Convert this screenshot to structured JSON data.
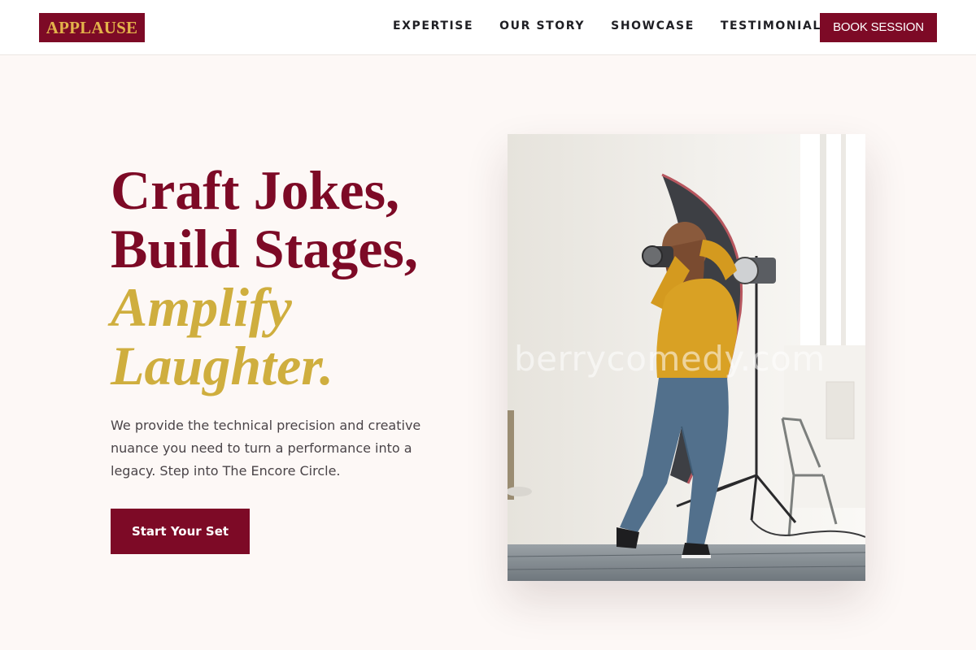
{
  "brand": {
    "logo_text": "APPLAUSE",
    "primary_color": "#7d0a26",
    "accent_color": "#cfae3e"
  },
  "nav": {
    "links": [
      "EXPERTISE",
      "OUR STORY",
      "SHOWCASE",
      "TESTIMONIALS"
    ],
    "cta_label": "BOOK SESSION"
  },
  "hero": {
    "title_lines": [
      "Craft Jokes,",
      "Build Stages,"
    ],
    "accent_lines": [
      "Amplify",
      "Laughter."
    ],
    "description": "We provide the technical precision and creative nuance you need to turn a performance into a legacy. Step into The Encore Circle.",
    "cta_label": "Start Your Set",
    "image": {
      "watermark": "berrycomedy.com",
      "subject": "photographer-with-studio-lights"
    }
  }
}
